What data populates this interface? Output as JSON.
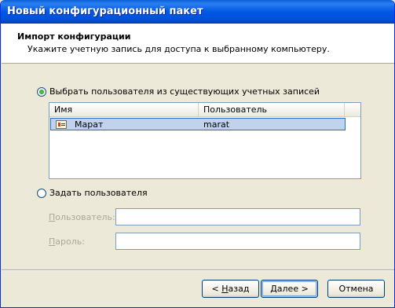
{
  "window": {
    "title": "Новый конфигурационный пакет"
  },
  "header": {
    "title": "Импорт конфигурации",
    "subtitle": "Укажите учетную запись для доступа к выбранному компьютеру."
  },
  "options": {
    "existing": {
      "label": "Выбрать пользователя из существующих учетных записей",
      "checked": true
    },
    "custom": {
      "label": "Задать пользователя",
      "checked": false
    }
  },
  "accounts_list": {
    "columns": [
      "Имя",
      "Пользователь"
    ],
    "rows": [
      {
        "name": "Марат",
        "user": "marat",
        "icon": "user-card-icon",
        "selected": true
      }
    ]
  },
  "fields": {
    "user": {
      "label_accel": "П",
      "label_rest": "ользователь:",
      "value": ""
    },
    "password": {
      "label_accel": "П",
      "label_rest": "ароль:",
      "value": ""
    }
  },
  "buttons": {
    "back": {
      "prefix": "< ",
      "accel": "Н",
      "rest": "азад"
    },
    "next": {
      "accel": "Д",
      "rest": "алее >"
    },
    "cancel": {
      "label": "Отмена"
    }
  }
}
